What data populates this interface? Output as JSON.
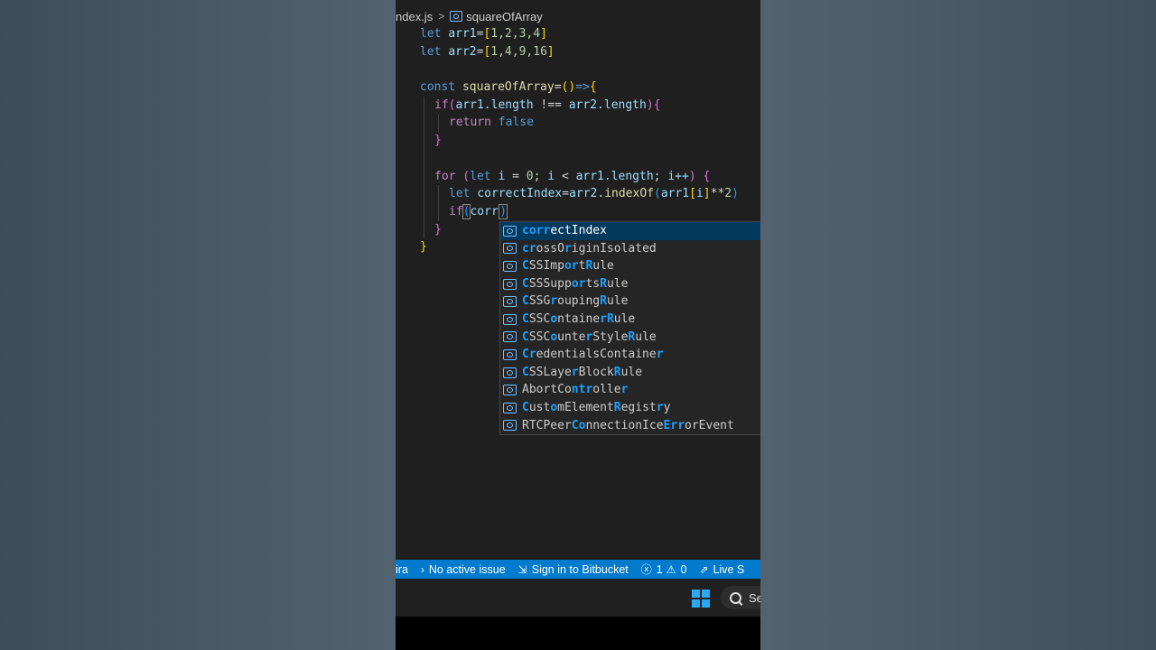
{
  "breadcrumb": {
    "file": "ndex.js",
    "separator": ">",
    "symbol": "squareOfArray",
    "symbol_icon": "variable-icon"
  },
  "code": {
    "l1": {
      "kw": "let",
      "var": "arr1",
      "rest": "=",
      "b_open": "[",
      "vals": "1,2,3,4",
      "b_close": "]"
    },
    "l2": {
      "kw": "let",
      "var": "arr2",
      "rest": "=",
      "b_open": "[",
      "vals": "1,4,9,16",
      "b_close": "]"
    },
    "l4": {
      "kw": "const",
      "fn": "squareOfArray",
      "eq": "=",
      "p": "()",
      "arrow": "=>",
      "brace": "{"
    },
    "l5": {
      "kw": "if",
      "p_open": "(",
      "a": "arr1",
      "a_prop": ".length",
      "op": " !== ",
      "b": "arr2",
      "b_prop": ".length",
      "p_close": ")",
      "brace": "{"
    },
    "l6": {
      "kw": "return",
      "val": " false"
    },
    "l7": {
      "brace": "}"
    },
    "l9": {
      "kw": "for",
      "p_open": " (",
      "let": "let",
      "i": " i",
      "eq": " = ",
      "zero": "0",
      "semi1": "; ",
      "i2": "i",
      "lt": " < ",
      "arr": "arr1",
      "prop": ".length",
      "semi2": "; ",
      "inc": "i++",
      "p_close": ")",
      "brace": " {"
    },
    "l10": {
      "kw": "let",
      "var": " correctIndex",
      "eq": "=",
      "arr": "arr2",
      "method": ".indexOf",
      "p_open": "(",
      "arg": "arr1",
      "b_open": "[",
      "idx": "i",
      "b_close": "]",
      "op": "**",
      "two": "2",
      "p_close": ")"
    },
    "l11": {
      "kw": "if",
      "p_open": "(",
      "typed": "corr",
      "p_close": ")"
    },
    "l12": {
      "brace": "}"
    },
    "l13": {
      "brace": "}"
    }
  },
  "suggestions": [
    {
      "icon": "variable-icon",
      "parts": [
        [
          "corr",
          true
        ],
        [
          "ectIndex",
          false
        ]
      ]
    },
    {
      "icon": "variable-icon",
      "parts": [
        [
          "c",
          true
        ],
        [
          "r",
          true
        ],
        [
          "oss",
          false
        ],
        [
          "O",
          false
        ],
        [
          "r",
          true
        ],
        [
          "iginIsolated",
          false
        ]
      ]
    },
    {
      "icon": "variable-icon",
      "parts": [
        [
          "C",
          true
        ],
        [
          "SSImp",
          false
        ],
        [
          "or",
          true
        ],
        [
          "t",
          false
        ],
        [
          "R",
          true
        ],
        [
          "ule",
          false
        ]
      ]
    },
    {
      "icon": "variable-icon",
      "parts": [
        [
          "C",
          true
        ],
        [
          "SSSupp",
          false
        ],
        [
          "or",
          true
        ],
        [
          "ts",
          false
        ],
        [
          "R",
          true
        ],
        [
          "ule",
          false
        ]
      ]
    },
    {
      "icon": "variable-icon",
      "parts": [
        [
          "C",
          true
        ],
        [
          "SSG",
          false
        ],
        [
          "r",
          true
        ],
        [
          "ouping",
          false
        ],
        [
          "R",
          true
        ],
        [
          "ule",
          false
        ]
      ]
    },
    {
      "icon": "variable-icon",
      "parts": [
        [
          "C",
          true
        ],
        [
          "SSC",
          false
        ],
        [
          "o",
          true
        ],
        [
          "ntaine",
          false
        ],
        [
          "r",
          true
        ],
        [
          "R",
          true
        ],
        [
          "ule",
          false
        ]
      ]
    },
    {
      "icon": "variable-icon",
      "parts": [
        [
          "C",
          true
        ],
        [
          "SSC",
          false
        ],
        [
          "o",
          true
        ],
        [
          "unte",
          false
        ],
        [
          "r",
          true
        ],
        [
          "Style",
          false
        ],
        [
          "R",
          true
        ],
        [
          "ule",
          false
        ]
      ]
    },
    {
      "icon": "variable-icon",
      "parts": [
        [
          "C",
          true
        ],
        [
          "r",
          true
        ],
        [
          "edentialsContaine",
          false
        ],
        [
          "r",
          true
        ]
      ]
    },
    {
      "icon": "variable-icon",
      "parts": [
        [
          "C",
          true
        ],
        [
          "SSLaye",
          false
        ],
        [
          "r",
          true
        ],
        [
          "Block",
          false
        ],
        [
          "R",
          true
        ],
        [
          "ule",
          false
        ]
      ]
    },
    {
      "icon": "variable-icon",
      "parts": [
        [
          "AbortCo",
          false
        ],
        [
          "ntr",
          true
        ],
        [
          "olle",
          false
        ],
        [
          "r",
          true
        ]
      ]
    },
    {
      "icon": "variable-icon",
      "parts": [
        [
          "C",
          true
        ],
        [
          "ust",
          false
        ],
        [
          "o",
          true
        ],
        [
          "mElement",
          false
        ],
        [
          "R",
          true
        ],
        [
          "egist",
          false
        ],
        [
          "r",
          true
        ],
        [
          "y",
          false
        ]
      ]
    },
    {
      "icon": "variable-icon",
      "parts": [
        [
          "RTCPeer",
          false
        ],
        [
          "C",
          true
        ],
        [
          "o",
          true
        ],
        [
          "nnectionIce",
          false
        ],
        [
          "Err",
          true
        ],
        [
          "orEvent",
          false
        ]
      ]
    }
  ],
  "statusbar": {
    "jira": "ira",
    "issue_icon": "chevron-right-icon",
    "issue": "No active issue",
    "bitbucket_icon": "sign-in-icon",
    "bitbucket": "Sign in to Bitbucket",
    "errors": "1",
    "warnings": "0",
    "live_icon": "live-share-icon",
    "live": "Live S"
  },
  "taskbar": {
    "search_text": "Se"
  },
  "colors": {
    "statusbar": "#007acc",
    "editor_bg": "#1f1f1f",
    "selected": "#04395e",
    "match": "#18a3ff"
  }
}
